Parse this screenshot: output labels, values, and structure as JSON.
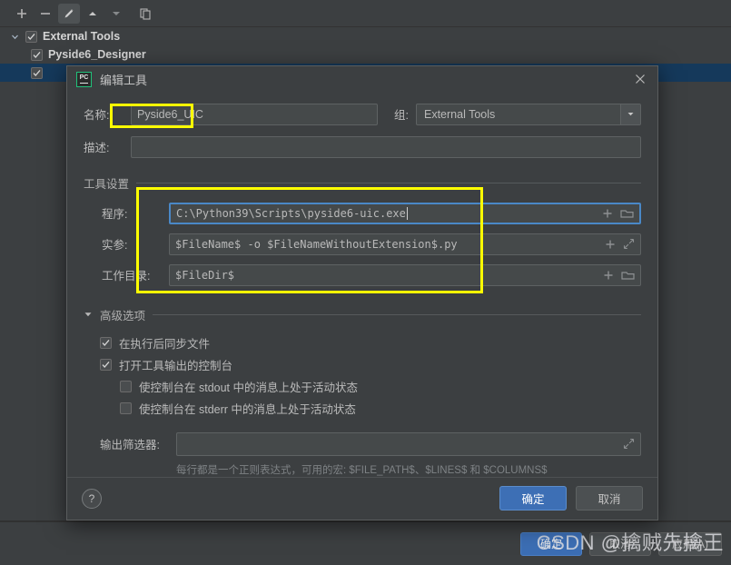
{
  "toolbar": {
    "buttons": [
      {
        "name": "add-button",
        "icon": "plus-icon",
        "label": "+"
      },
      {
        "name": "remove-button",
        "icon": "minus-icon",
        "label": "−"
      },
      {
        "name": "edit-button",
        "icon": "pencil-icon",
        "label": "edit"
      },
      {
        "name": "move-up-button",
        "icon": "arrow-up-icon",
        "label": "up"
      },
      {
        "name": "move-down-button",
        "icon": "arrow-down-icon",
        "label": "down"
      },
      {
        "name": "copy-button",
        "icon": "copy-icon",
        "label": "copy"
      }
    ]
  },
  "tree": {
    "items": [
      {
        "label": "External Tools",
        "checked": true,
        "expanded": true,
        "level": 0,
        "selected": false
      },
      {
        "label": "Pyside6_Designer",
        "checked": true,
        "level": 1,
        "selected": false
      },
      {
        "label": "",
        "checked": true,
        "level": 1,
        "selected": true
      }
    ]
  },
  "background_buttons": {
    "ok": "确定",
    "cancel": "取消",
    "apply": "应用(A)"
  },
  "watermark": "CSDN @擒贼先擒王",
  "dialog": {
    "title": "编辑工具",
    "icon": "pycharm-icon",
    "icon_text": "PC",
    "close_icon": "close-icon",
    "name": {
      "label": "名称:",
      "value": "Pyside6_UIC"
    },
    "group": {
      "label": "组:",
      "value": "External Tools",
      "arrow_icon": "chevron-down-icon"
    },
    "description": {
      "label": "描述:",
      "value": ""
    },
    "tool_settings": {
      "title": "工具设置",
      "program": {
        "label": "程序:",
        "value": "C:\\Python39\\Scripts\\pyside6-uic.exe",
        "focused": true,
        "actions": [
          "insert-macro-icon",
          "browse-folder-icon"
        ]
      },
      "arguments": {
        "label": "实参:",
        "value": "$FileName$ -o $FileNameWithoutExtension$.py",
        "actions": [
          "insert-macro-icon",
          "expand-editor-icon"
        ]
      },
      "working_directory": {
        "label": "工作目录:",
        "value": "$FileDir$",
        "actions": [
          "insert-macro-icon",
          "browse-folder-icon"
        ]
      }
    },
    "advanced_options": {
      "title": "高级选项",
      "expanded": true,
      "items": [
        {
          "label": "在执行后同步文件",
          "checked": true,
          "sub": false
        },
        {
          "label": "打开工具输出的控制台",
          "checked": true,
          "sub": false
        },
        {
          "label": "使控制台在 stdout 中的消息上处于活动状态",
          "checked": false,
          "sub": true
        },
        {
          "label": "使控制台在 stderr 中的消息上处于活动状态",
          "checked": false,
          "sub": true
        }
      ]
    },
    "output_filter": {
      "label": "输出筛选器:",
      "value": "",
      "expand_icon": "expand-editor-icon",
      "hint": "每行都是一个正则表达式，可用的宏: $FILE_PATH$、$LINES$ 和 $COLUMNS$"
    },
    "footer": {
      "help": "?",
      "ok": "确定",
      "cancel": "取消"
    }
  },
  "colors": {
    "window_bg": "#3c3f41",
    "field_bg": "#45494a",
    "accent_blue": "#3d6fb5",
    "focus_blue": "#4a88c7",
    "highlight_yellow": "#ffff00",
    "selection_blue": "#15395b",
    "icon_green": "#21c17a"
  }
}
